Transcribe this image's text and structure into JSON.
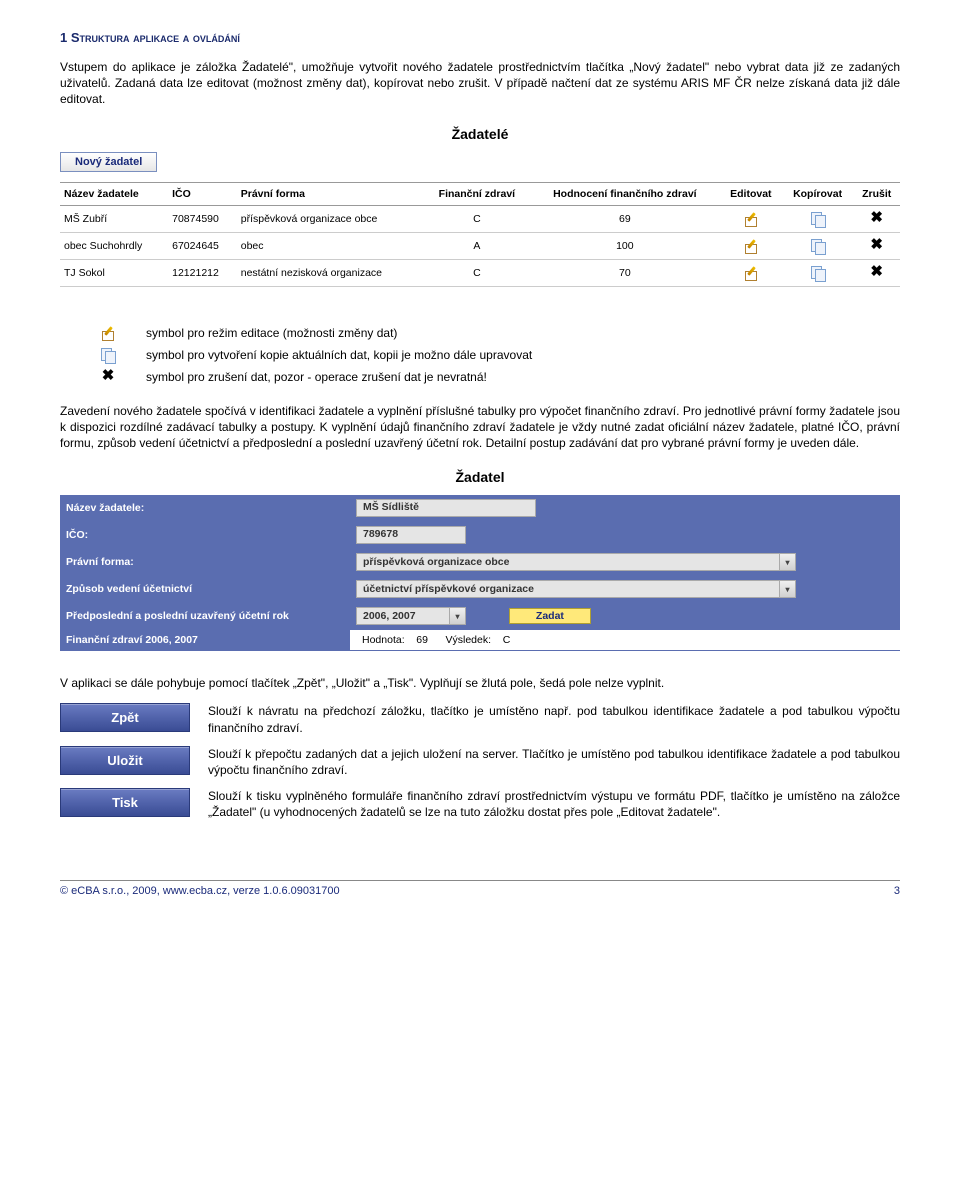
{
  "heading": "1 Struktura aplikace a ovládání",
  "intro_p1": "Vstupem do aplikace je záložka Žadatelé\", umožňuje vytvořit nového žadatele prostřednictvím tlačítka „Nový žadatel\" nebo vybrat data již ze zadaných uživatelů. Zadaná data lze editovat (možnost změny dat), kopírovat nebo zrušit. V případě načtení dat ze systému ARIS MF ČR nelze získaná data již dále editovat.",
  "app1": {
    "title": "Žadatelé",
    "new_btn": "Nový žadatel",
    "headers": [
      "Název žadatele",
      "IČO",
      "Právní forma",
      "Finanční zdraví",
      "Hodnocení finančního zdraví",
      "Editovat",
      "Kopírovat",
      "Zrušit"
    ],
    "rows": [
      {
        "name": "MŠ Zubří",
        "ico": "70874590",
        "form": "příspěvková organizace obce",
        "fin": "C",
        "rating": "69"
      },
      {
        "name": "obec Suchohrdly",
        "ico": "67024645",
        "form": "obec",
        "fin": "A",
        "rating": "100"
      },
      {
        "name": "TJ Sokol",
        "ico": "12121212",
        "form": "nestátní nezisková organizace",
        "fin": "C",
        "rating": "70"
      }
    ]
  },
  "legend": {
    "edit": "symbol pro režim editace (možnosti změny dat)",
    "copy": "symbol pro vytvoření kopie aktuálních dat, kopii je možno dále upravovat",
    "delete": "symbol pro zrušení dat, pozor - operace zrušení dat je nevratná!"
  },
  "para2": "Zavedení nového žadatele spočívá v identifikaci žadatele a vyplnění příslušné tabulky pro výpočet finančního zdraví. Pro jednotlivé právní formy žadatele jsou k dispozici rozdílné zadávací tabulky a postupy. K vyplnění údajů finančního zdraví žadatele je vždy nutné zadat oficiální název žadatele, platné IČO, právní formu, způsob vedení účetnictví a předposlední a poslední uzavřený účetní rok. Detailní postup zadávání dat pro vybrané právní formy je uveden dále.",
  "form": {
    "title": "Žadatel",
    "name_label": "Název žadatele:",
    "name_value": "MŠ Sídliště",
    "ico_label": "IČO:",
    "ico_value": "789678",
    "pf_label": "Právní forma:",
    "pf_value": "příspěvková organizace obce",
    "acc_label": "Způsob vedení účetnictví",
    "acc_value": "účetnictví příspěvkové organizace",
    "years_label": "Předposlední a poslední uzavřený účetní rok",
    "years_value": "2006, 2007",
    "zadat_btn": "Zadat",
    "result_label": "Finanční zdraví 2006, 2007",
    "result_hodnota": "Hodnota:",
    "result_hodnota_val": "69",
    "result_vysledek": "Výsledek:",
    "result_vysledek_val": "C"
  },
  "para3": "V aplikaci se dále pohybuje pomocí tlačítek „Zpět\", „Uložit\" a „Tisk\". Vyplňují se žlutá pole, šedá pole nelze vyplnit.",
  "actions": {
    "zpet": {
      "label": "Zpět",
      "text": "Slouží k návratu na předchozí záložku, tlačítko je umístěno např. pod tabulkou identifikace žadatele a pod tabulkou výpočtu finančního zdraví."
    },
    "ulozit": {
      "label": "Uložit",
      "text": "Slouží k přepočtu zadaných dat a jejich uložení na server. Tlačítko je umístěno pod tabulkou identifikace žadatele a pod tabulkou výpočtu finančního zdraví."
    },
    "tisk": {
      "label": "Tisk",
      "text": "Slouží k tisku vyplněného formuláře finančního zdraví prostřednictvím výstupu ve formátu PDF, tlačítko je umístěno na záložce „Žadatel\" (u vyhodnocených žadatelů se lze na tuto záložku dostat přes pole „Editovat žadatele\"."
    }
  },
  "footer": {
    "left": "© eCBA s.r.o., 2009, www.ecba.cz, verze 1.0.6.09031700",
    "right": "3"
  }
}
